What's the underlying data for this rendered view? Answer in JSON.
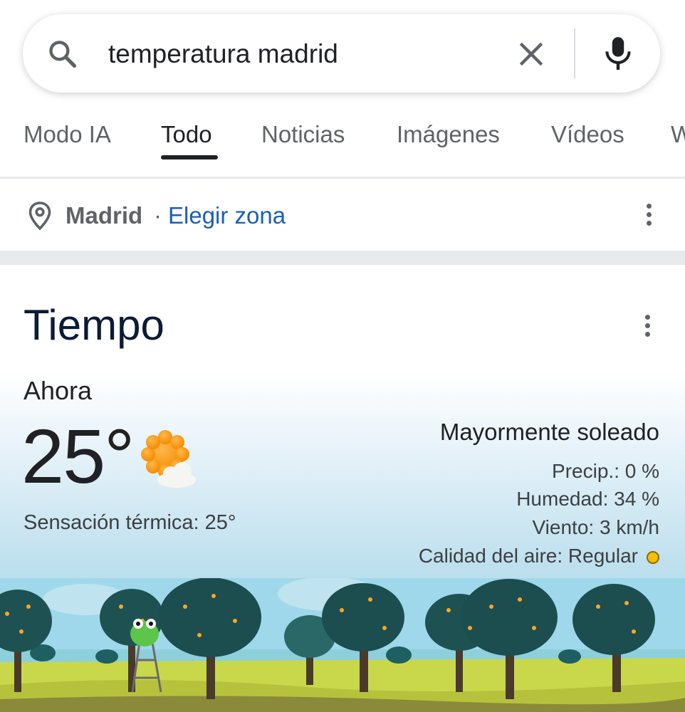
{
  "search": {
    "query": "temperatura madrid"
  },
  "tabs": [
    {
      "label": "Modo IA"
    },
    {
      "label": "Todo"
    },
    {
      "label": "Noticias"
    },
    {
      "label": "Imágenes"
    },
    {
      "label": "Vídeos"
    },
    {
      "label": "W"
    }
  ],
  "location": {
    "city": "Madrid",
    "separator": "·",
    "choose_zone": "Elegir zona"
  },
  "weather": {
    "title": "Tiempo",
    "now_label": "Ahora",
    "temperature": "25°",
    "feels_like": "Sensación térmica: 25°",
    "condition": "Mayormente soleado",
    "precip": "Precip.: 0 %",
    "humidity": "Humedad: 34 %",
    "wind": "Viento: 3 km/h",
    "air_quality": "Calidad del aire: Regular",
    "air_quality_color": "#fbbc04",
    "icon": "mostly-sunny-icon"
  },
  "colors": {
    "link": "#1a5fb4",
    "active_tab": "#202124"
  }
}
